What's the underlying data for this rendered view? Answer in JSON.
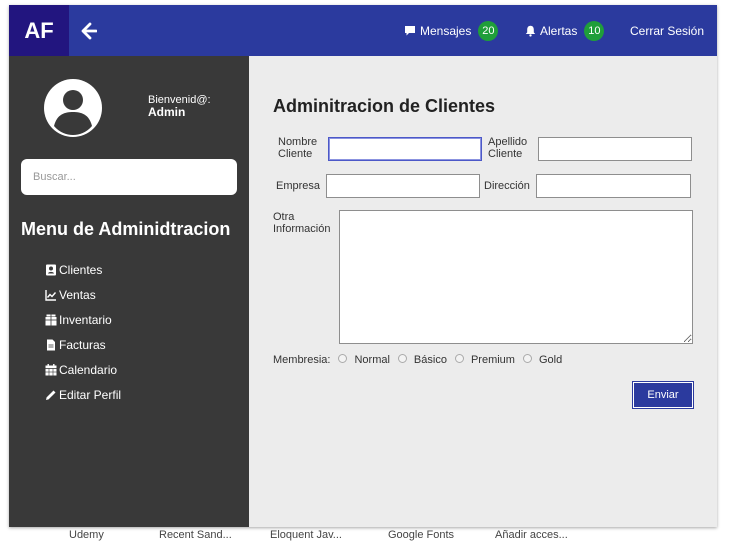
{
  "header": {
    "logo": "AF",
    "messages_label": "Mensajes",
    "messages_count": "20",
    "alerts_label": "Alertas",
    "alerts_count": "10",
    "logout_label": "Cerrar Sesión",
    "badge_color": "#1f9e3a",
    "bar_color": "#2b3a9e"
  },
  "sidebar": {
    "welcome": "Bienvenid@:",
    "user": "Admin",
    "search_placeholder": "Buscar...",
    "menu_title": "Menu de Adminidtracion",
    "items": [
      {
        "label": "Clientes",
        "icon": "contact-card-icon"
      },
      {
        "label": "Ventas",
        "icon": "line-chart-icon"
      },
      {
        "label": "Inventario",
        "icon": "package-icon"
      },
      {
        "label": "Facturas",
        "icon": "document-icon"
      },
      {
        "label": "Calendario",
        "icon": "calendar-icon"
      },
      {
        "label": "Editar Perfil",
        "icon": "pencil-icon"
      }
    ]
  },
  "form": {
    "title": "Adminitracion de Clientes",
    "nombre_label": "Nombre Cliente",
    "apellido_label": "Apellido Cliente",
    "empresa_label": "Empresa",
    "direccion_label": "Dirección",
    "otra_label": "Otra Información",
    "membresia_label": "Membresia:",
    "options": [
      "Normal",
      "Básico",
      "Premium",
      "Gold"
    ],
    "submit_label": "Enviar"
  },
  "bookmarks": [
    "Udemy",
    "Recent Sand...",
    "Eloquent Jav...",
    "Google Fonts",
    "Añadir acces..."
  ]
}
